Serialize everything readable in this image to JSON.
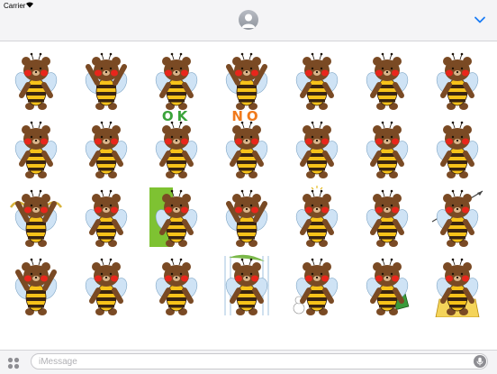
{
  "status_bar": {
    "carrier": "Carrier",
    "wifi_icon": "wifi-icon"
  },
  "header": {
    "avatar_icon": "person-icon",
    "expand_icon": "chevron-down-icon",
    "accent": "#1a7cf5"
  },
  "stickers": {
    "row1": [
      "bee-bear-standing",
      "bee-bear-waving",
      "bee-bear-pointing",
      "bee-bear-cheering",
      "bee-bear-flexing",
      "bee-bear-thinking",
      "bee-bear-praying"
    ],
    "row2": [
      "bee-bear-dancing",
      "bee-bear-shy",
      "bee-bear-ok",
      "bee-bear-no",
      "bee-bear-running",
      "bee-bear-pouting",
      "bee-bear-eating"
    ],
    "row3": [
      "bee-bear-angel",
      "bee-bear-lying",
      "bee-bear-peeking",
      "bee-bear-excited",
      "bee-bear-idea",
      "bee-bear-smiling",
      "bee-bear-spear"
    ],
    "row4": [
      "bee-bear-arms-out",
      "bee-bear-dizzy",
      "bee-bear-sad",
      "bee-bear-rain",
      "bee-bear-snowman",
      "bee-bear-drinking",
      "bee-bear-honeycomb"
    ],
    "ok_text": "OK",
    "no_text": "NO",
    "colors": {
      "fur": "#7a4a24",
      "stripe_yellow": "#f6c21a",
      "stripe_dark": "#3a2410",
      "cheek": "#e8261c",
      "wing": "#cfe3f5",
      "ok": "#3aa33a",
      "no": "#f07a1c",
      "panel_green": "#7ec232"
    }
  },
  "composer": {
    "placeholder": "iMessage",
    "apps_icon": "apps-grid-icon",
    "mic_icon": "microphone-icon"
  }
}
